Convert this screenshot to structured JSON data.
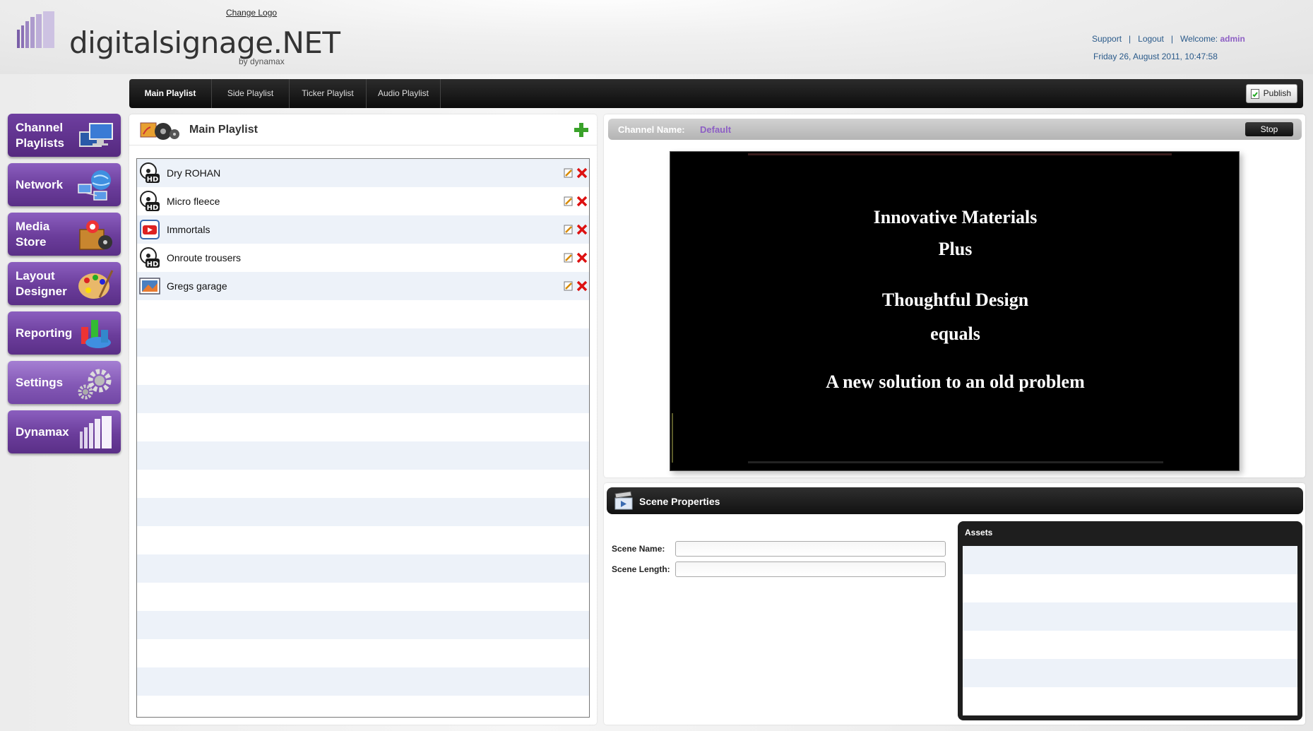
{
  "header": {
    "change_logo": "Change Logo",
    "logo_text": "digitalsignage.NET",
    "logo_sub": "by dynamax",
    "support": "Support",
    "logout": "Logout",
    "welcome_label": "Welcome:",
    "welcome_user": "admin",
    "datetime": "Friday 26, August 2011, 10:47:58",
    "separator": "|"
  },
  "nav": {
    "items": [
      {
        "label": "Channel\nPlaylists",
        "icon": "monitors-icon"
      },
      {
        "label": "Network",
        "icon": "network-globe-icon"
      },
      {
        "label": "Media\nStore",
        "icon": "media-box-icon"
      },
      {
        "label": "Layout\nDesigner",
        "icon": "palette-icon"
      },
      {
        "label": "Reporting",
        "icon": "chart-icon"
      },
      {
        "label": "Settings",
        "icon": "gears-icon"
      },
      {
        "label": "Dynamax",
        "icon": "dynamax-logo-icon"
      }
    ]
  },
  "tabs": {
    "items": [
      {
        "label": "Main Playlist"
      },
      {
        "label": "Side Playlist"
      },
      {
        "label": "Ticker Playlist"
      },
      {
        "label": "Audio Playlist"
      }
    ],
    "publish": "Publish"
  },
  "playlist": {
    "title": "Main Playlist",
    "items": [
      {
        "name": "Dry ROHAN",
        "icon": "hd-video-icon"
      },
      {
        "name": "Micro fleece",
        "icon": "hd-video-icon"
      },
      {
        "name": "Immortals",
        "icon": "youtube-icon"
      },
      {
        "name": "Onroute trousers",
        "icon": "hd-video-icon"
      },
      {
        "name": "Gregs garage",
        "icon": "image-icon"
      }
    ]
  },
  "preview": {
    "channel_label": "Channel Name:",
    "channel_name": "Default",
    "stop": "Stop",
    "slide_lines": [
      "Innovative Materials",
      "Plus",
      "Thoughtful Design",
      "equals",
      "A new solution to an old problem"
    ]
  },
  "scene": {
    "title": "Scene Properties",
    "name_label": "Scene Name:",
    "name_value": "",
    "length_label": "Scene Length:",
    "length_value": "",
    "assets_title": "Assets"
  },
  "colors": {
    "accent_purple": "#6b3d9b",
    "welcome_user": "#8d5fc4",
    "link_blue": "#2a5a8a",
    "row_alt": "#edf2f9"
  }
}
